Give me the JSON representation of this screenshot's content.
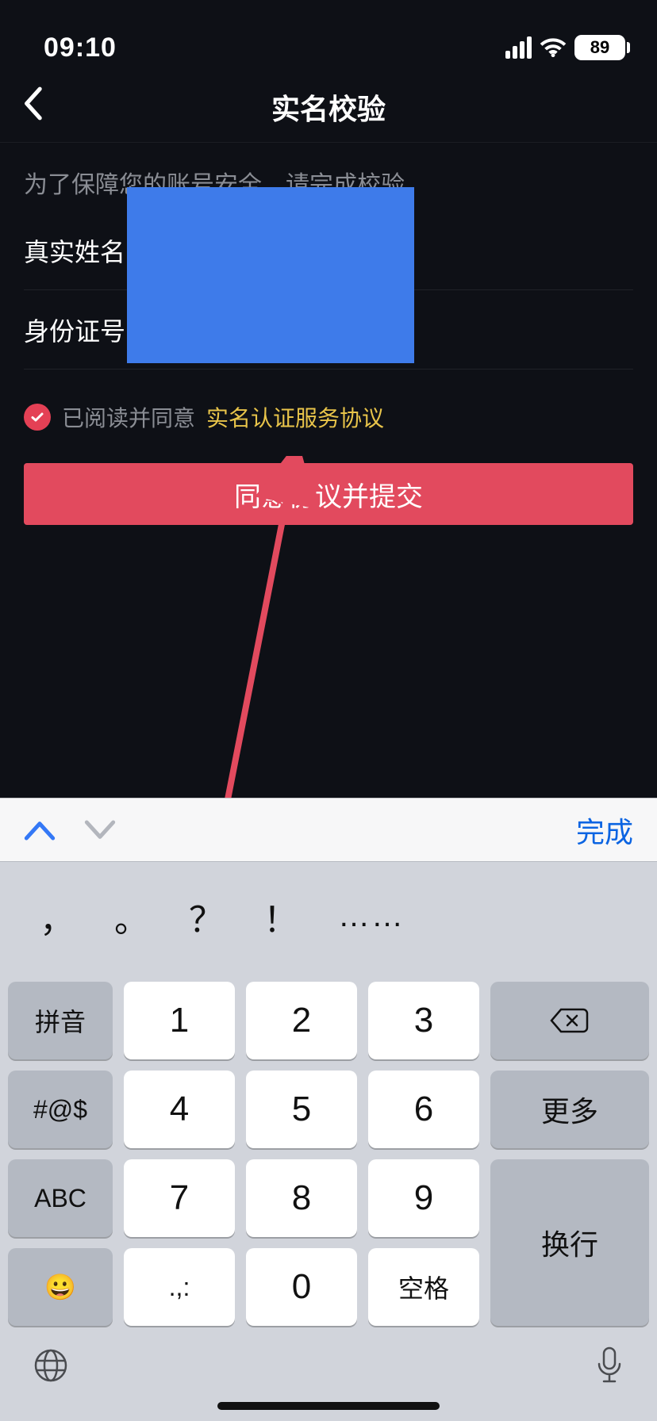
{
  "status": {
    "time": "09:10",
    "battery": "89"
  },
  "header": {
    "title": "实名校验"
  },
  "hint": "为了保障您的账号安全，请完成校验",
  "form": {
    "name_label": "真实姓名",
    "id_label": "身份证号"
  },
  "agreement": {
    "read_label": "已阅读并同意",
    "link_label": "实名认证服务协议"
  },
  "submit_label": "同意协议并提交",
  "keyboard": {
    "done": "完成",
    "punct": {
      "comma": "，",
      "period": "。",
      "question": "？",
      "exclaim": "！",
      "dots": "……"
    },
    "side": {
      "pinyin": "拼音",
      "sym": "#@$",
      "abc": "ABC",
      "emoji": "😀",
      "more": "更多",
      "enter": "换行"
    },
    "nums": {
      "k1": "1",
      "k2": "2",
      "k3": "3",
      "k4": "4",
      "k5": "5",
      "k6": "6",
      "k7": "7",
      "k8": "8",
      "k9": "9",
      "k0": "0",
      "kpunct": ".,:",
      "space": "空格"
    }
  }
}
